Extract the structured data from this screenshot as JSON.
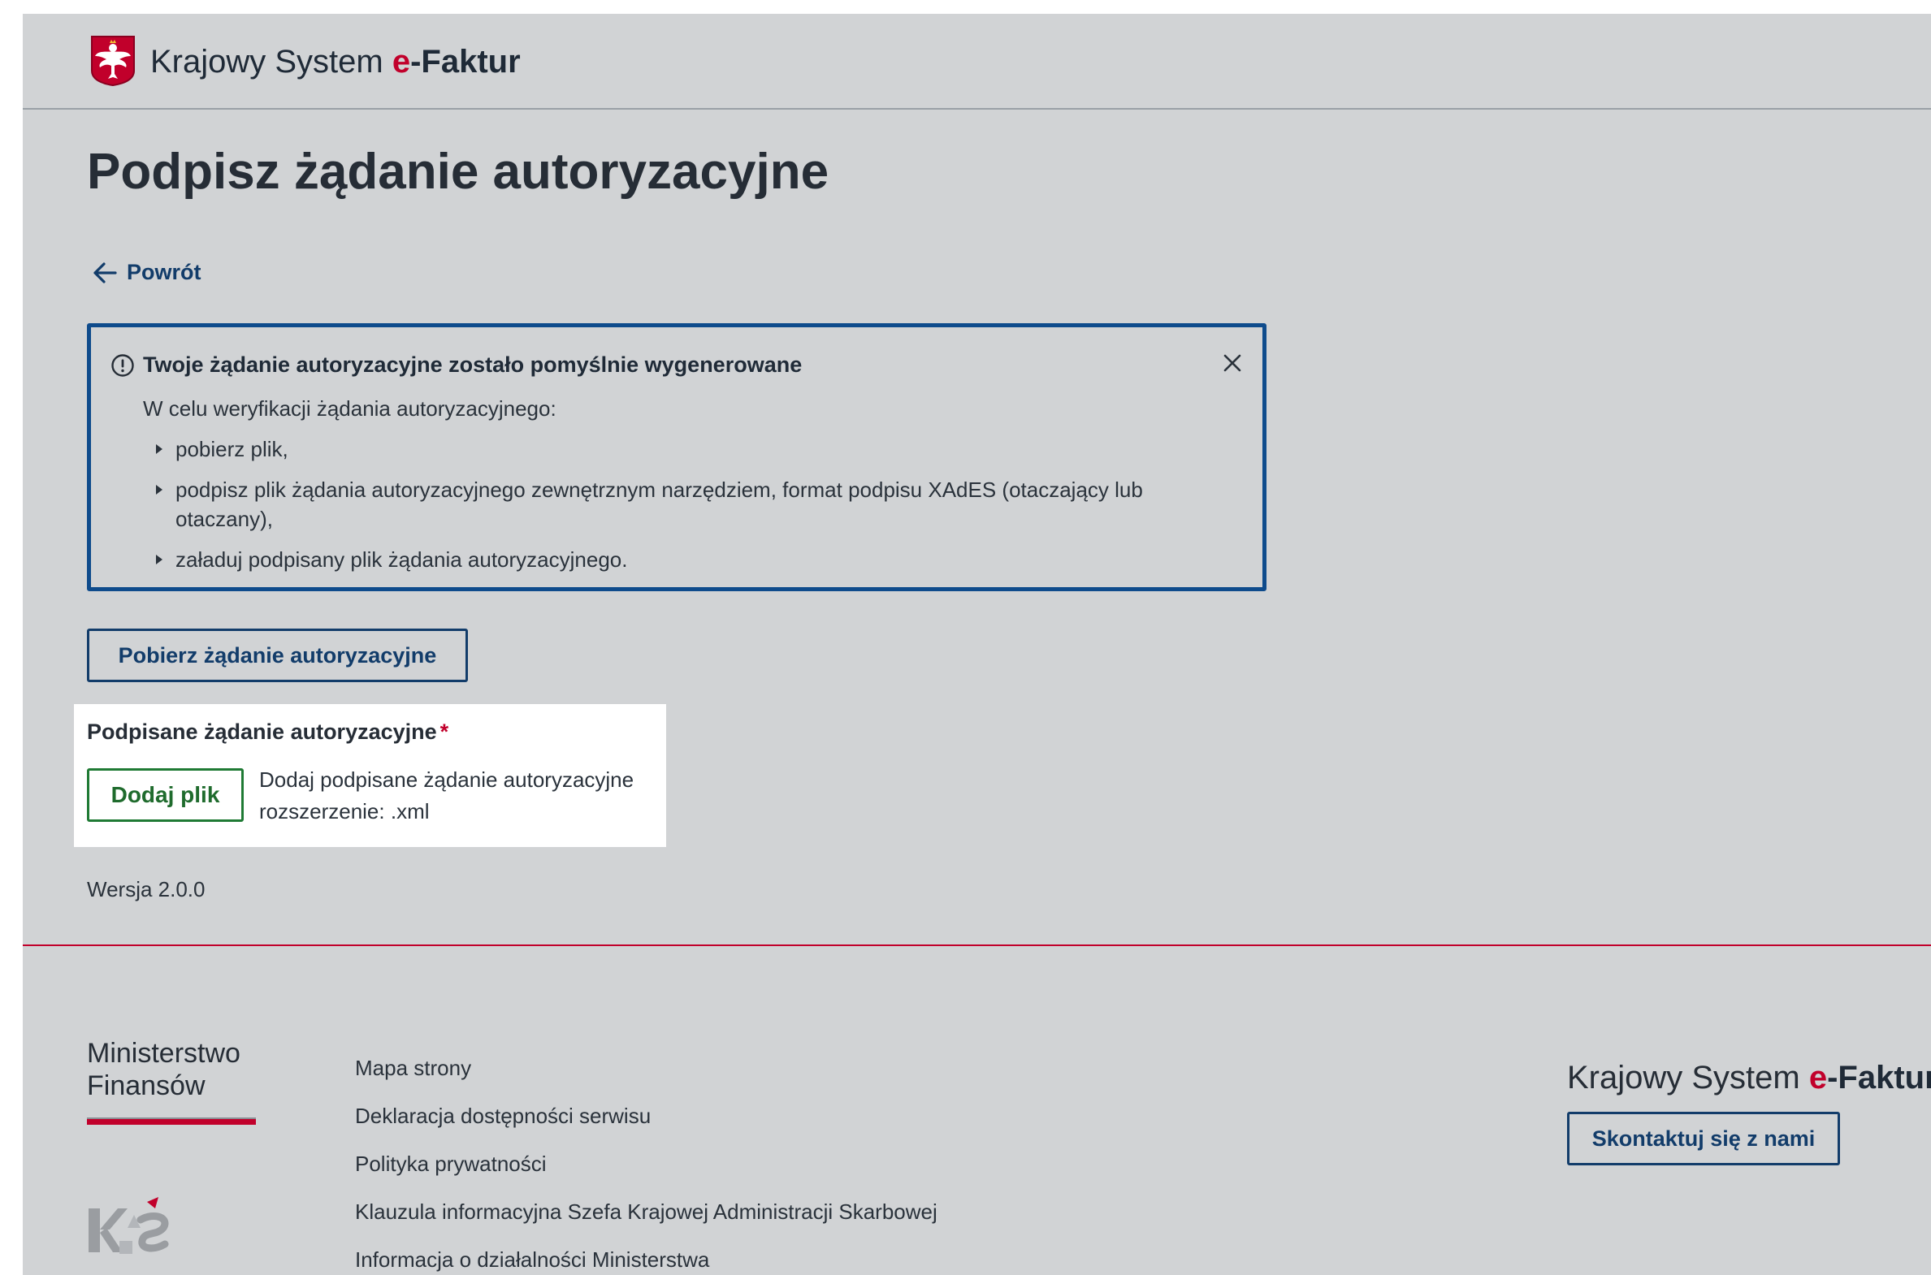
{
  "header": {
    "emblem_icon": "polish-eagle-emblem-icon",
    "brand": {
      "prefix": "Krajowy System ",
      "accent": "e",
      "suffix": "-Faktur"
    }
  },
  "page": {
    "title": "Podpisz żądanie autoryzacyjne",
    "back_link": {
      "icon": "arrow-left-icon",
      "label": "Powrót"
    }
  },
  "alert": {
    "icon": "info-circle-icon",
    "title": "Twoje żądanie autoryzacyjne zostało pomyślnie wygenerowane",
    "close_icon": "close-icon",
    "intro": "W celu weryfikacji żądania autoryzacyjnego:",
    "items": [
      "pobierz plik,",
      "podpisz plik żądania autoryzacyjnego zewnętrznym narzędziem, format podpisu XAdES (otaczający lub otaczany),",
      "załaduj podpisany plik żądania autoryzacyjnego."
    ]
  },
  "download_button": {
    "label": "Pobierz żądanie autoryzacyjne"
  },
  "upload": {
    "label": "Podpisane żądanie autoryzacyjne",
    "required_mark": "*",
    "button_label": "Dodaj plik",
    "hint_line1": "Dodaj podpisane żądanie autoryzacyjne",
    "hint_line2": "rozszerzenie: .xml"
  },
  "version": "Wersja 2.0.0",
  "footer": {
    "ministry_logo": {
      "line1": "Ministerstwo",
      "line2": "Finansów"
    },
    "kas_logo_icon": "kas-logo-icon",
    "links": [
      "Mapa strony",
      "Deklaracja dostępności serwisu",
      "Polityka prywatności",
      "Klauzula informacyjna Szefa Krajowej Administracji Skarbowej",
      "Informacja o działalności Ministerstwa"
    ],
    "brand": {
      "prefix": "Krajowy System ",
      "accent": "e",
      "suffix": "-Faktur"
    },
    "contact_button": "Skontaktuj się z nami"
  },
  "colors": {
    "page_background": "#d1d3d5",
    "brand_red": "#c1002b",
    "primary_navy": "#123c6a",
    "alert_border": "#0e4b8c",
    "success_green": "#1f7a34",
    "text_dark": "#262d36"
  }
}
